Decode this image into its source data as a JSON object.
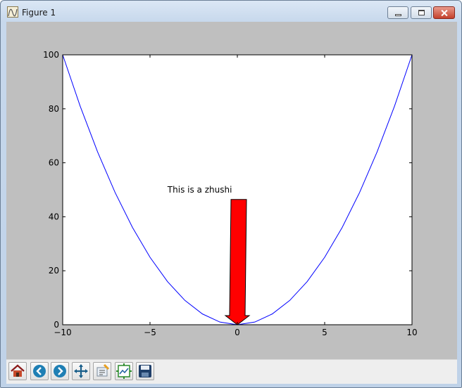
{
  "window": {
    "title": "Figure 1",
    "controls": [
      "minimize",
      "maximize",
      "close"
    ]
  },
  "toolbar": {
    "buttons": [
      {
        "name": "home",
        "icon": "home-icon"
      },
      {
        "name": "back",
        "icon": "back-arrow-icon"
      },
      {
        "name": "forward",
        "icon": "forward-arrow-icon"
      },
      {
        "name": "pan",
        "icon": "pan-move-icon"
      },
      {
        "name": "zoom",
        "icon": "zoom-rect-icon"
      },
      {
        "name": "configure-subplots",
        "icon": "subplots-icon"
      },
      {
        "name": "save",
        "icon": "save-disk-icon"
      }
    ]
  },
  "chart_data": {
    "type": "line",
    "title": "",
    "xlabel": "",
    "ylabel": "",
    "xlim": [
      -10,
      10
    ],
    "ylim": [
      0,
      100
    ],
    "xticks": [
      -10,
      -5,
      0,
      5,
      10
    ],
    "yticks": [
      0,
      20,
      40,
      60,
      80,
      100
    ],
    "grid": false,
    "series": [
      {
        "color": "#0000ff",
        "x": [
          -10,
          -9,
          -8,
          -7,
          -6,
          -5,
          -4,
          -3,
          -2,
          -1,
          0,
          1,
          2,
          3,
          4,
          5,
          6,
          7,
          8,
          9,
          10
        ],
        "y": [
          100,
          81,
          64,
          49,
          36,
          25,
          16,
          9,
          4,
          1,
          0,
          1,
          4,
          9,
          16,
          25,
          36,
          49,
          64,
          81,
          100
        ]
      }
    ],
    "annotations": [
      {
        "text": "This is a zhushi",
        "xy": [
          0,
          0
        ],
        "xytext": [
          -4,
          49
        ],
        "arrow_color": "#ff0000"
      }
    ]
  }
}
